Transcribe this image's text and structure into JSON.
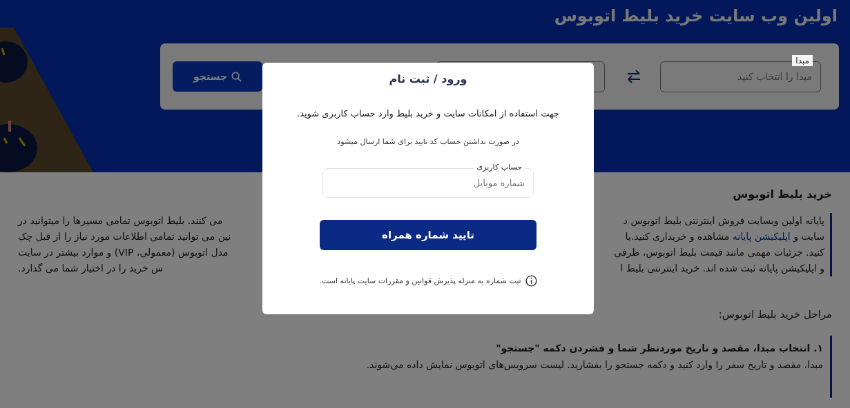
{
  "hero": {
    "title": "اولین وب سایت خرید بلیط اتوبوس"
  },
  "search": {
    "origin": {
      "label": "مبدا",
      "placeholder": "مبدا را انتخاب کنید"
    },
    "button": "جستجو"
  },
  "article": {
    "heading": "خرید بلیط اتوبوس",
    "intro_lines": [
      {
        "right": [
          {
            "kind": "text",
            "text": "پایانه اولین وبسایت فروش اینترنتی بلیط اتوبوس د"
          }
        ],
        "left": "می کنند. بلیط اتوبوس تمامی مسیرها را میتوانید در"
      },
      {
        "right": [
          {
            "kind": "text",
            "text": "سایت و "
          },
          {
            "kind": "link",
            "text": "اپلیکیشن پایانه"
          },
          {
            "kind": "text",
            "text": " مشاهده و خریداری کنید.با"
          }
        ],
        "left": "نین می توانید تمامی اطلاعات مورد نیاز را از قبل چک"
      },
      {
        "right": [
          {
            "kind": "text",
            "text": "کنید. جزئیات مهمی مانند قیمت بلیط اتوبوس، ظرفی"
          }
        ],
        "left": "مدل اتوبوس (معمولی، VIP) و موارد بیشتر در سایت"
      },
      {
        "right": [
          {
            "kind": "text",
            "text": "و اپلیکیشن پایانه ثبت شده اند. خرید اینترنتی بلیط ا"
          }
        ],
        "left": "س خرید را در اختیار شما می گذارد."
      }
    ],
    "steps_heading": "مراحل خرید بلیط اتوبوس:",
    "steps": [
      {
        "title": "۱. انتخاب مبدا، مقصد و تاریخ موردنظر شما و فشردن دکمه \"جستجو\"",
        "text": "مبدا، مقصد و تاریخ سفر را وارد کنید و دکمه جستجو را بفشارید. لیست سرویس‌های اتوبوس نمایش داده می‌شوند."
      }
    ]
  },
  "modal": {
    "title": "ورود / ثبت نام",
    "message": "جهت استفاده از امکانات سایت و خرید بلیط وارد حساب کاربری شوید.",
    "note": "در صورت نداشتن حساب کد تایید برای شما ارسال میشود",
    "field": {
      "label": "حساب کاربری",
      "placeholder": "شماره موبایل"
    },
    "button": "تایید شماره همراه",
    "footnote": "ثبت شماره به منزله پذیرش قوانین و مقررات سایت پایانه است."
  }
}
